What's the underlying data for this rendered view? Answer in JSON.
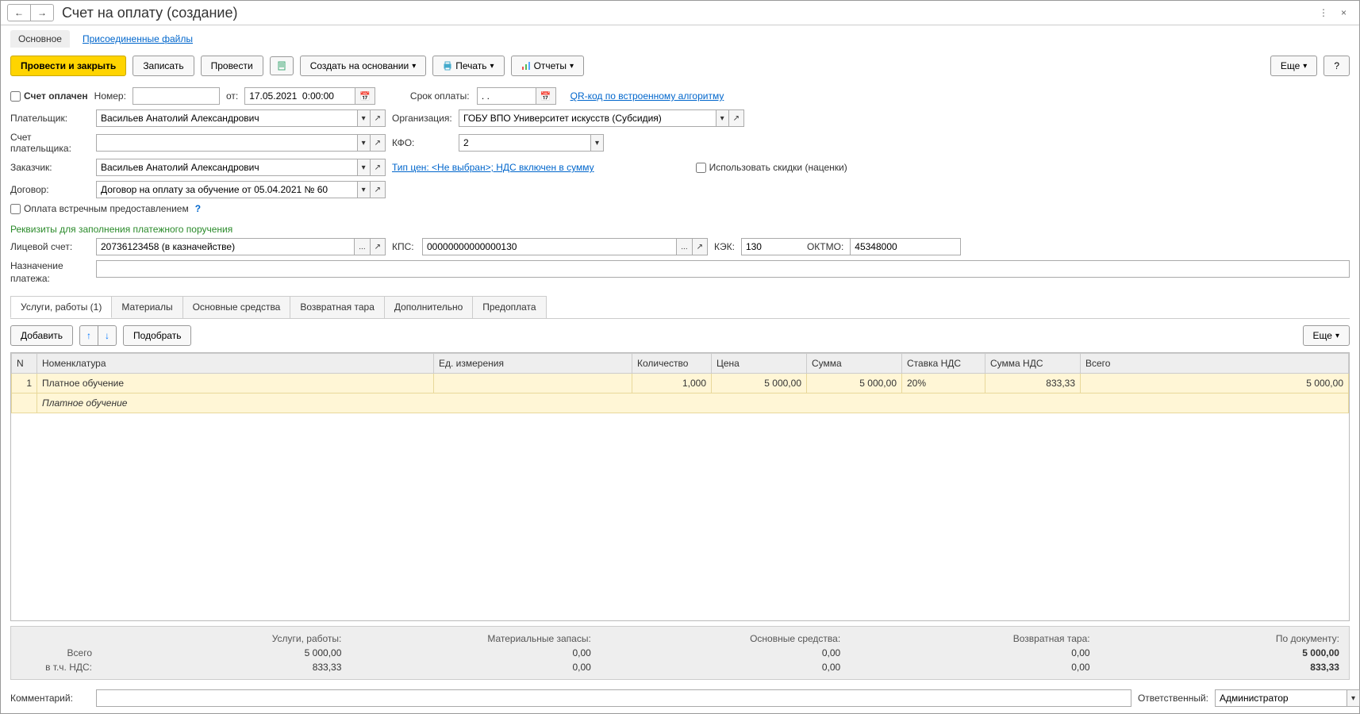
{
  "window": {
    "title": "Счет на оплату (создание)"
  },
  "navTabs": {
    "main": "Основное",
    "files": "Присоединенные файлы"
  },
  "toolbar": {
    "postAndClose": "Провести и закрыть",
    "save": "Записать",
    "post": "Провести",
    "createBased": "Создать на основании",
    "print": "Печать",
    "reports": "Отчеты",
    "more": "Еще",
    "help": "?"
  },
  "fields": {
    "paid_label": "Счет оплачен",
    "number_label": "Номер:",
    "number": "",
    "from_label": "от:",
    "date": "17.05.2021  0:00:00",
    "dueLabel": "Срок оплаты:",
    "due": ". .",
    "qr_link": "QR-код по встроенному алгоритму",
    "payerLabel": "Плательщик:",
    "payer": "Васильев Анатолий Александрович",
    "orgLabel": "Организация:",
    "org": "ГОБУ ВПО Университет искусств (Субсидия)",
    "payerAccLabel": "Счет плательщика:",
    "payerAcc": "",
    "kfoLabel": "КФО:",
    "kfo": "2",
    "customerLabel": "Заказчик:",
    "customer": "Васильев Анатолий Александрович",
    "priceTypeLink": "Тип цен: <Не выбран>; НДС включен в сумму",
    "discountsLabel": "Использовать скидки (наценки)",
    "contractLabel": "Договор:",
    "contract": "Договор на оплату за обучение от 05.04.2021 № 60",
    "counterPaymentLabel": "Оплата встречным предоставлением",
    "requisitesHeader": "Реквизиты для заполнения платежного поручения",
    "personalAccLabel": "Лицевой счет:",
    "personalAcc": "20736123458 (в казначействе)",
    "kpsLabel": "КПС:",
    "kps": "00000000000000130",
    "kekLabel": "КЭК:",
    "kek": "130",
    "oktmoLabel": "ОКТМО:",
    "oktmo": "45348000",
    "purposeLabel": "Назначение платежа:",
    "purpose": ""
  },
  "subTabs": {
    "services": "Услуги, работы (1)",
    "materials": "Материалы",
    "assets": "Основные средства",
    "returnable": "Возвратная тара",
    "additional": "Дополнительно",
    "prepay": "Предоплата"
  },
  "tabToolbar": {
    "add": "Добавить",
    "pick": "Подобрать",
    "more": "Еще"
  },
  "gridHeaders": {
    "n": "N",
    "nomenclature": "Номенклатура",
    "unit": "Ед. измерения",
    "qty": "Количество",
    "price": "Цена",
    "sum": "Сумма",
    "vatRate": "Ставка НДС",
    "vatSum": "Сумма НДС",
    "total": "Всего"
  },
  "gridRow": {
    "n": "1",
    "nomenclature": "Платное обучение",
    "sub": "Платное обучение",
    "unit": "",
    "qty": "1,000",
    "price": "5 000,00",
    "sum": "5 000,00",
    "vatRate": "20%",
    "vatSum": "833,33",
    "total": "5 000,00"
  },
  "summary": {
    "h_services": "Услуги, работы:",
    "h_materials": "Материальные запасы:",
    "h_assets": "Основные средства:",
    "h_returnable": "Возвратная тара:",
    "h_doc": "По документу:",
    "totalLabel": "Всего",
    "vatLabel": "в т.ч. НДС:",
    "services_total": "5 000,00",
    "materials_total": "0,00",
    "assets_total": "0,00",
    "returnable_total": "0,00",
    "doc_total": "5 000,00",
    "services_vat": "833,33",
    "materials_vat": "0,00",
    "assets_vat": "0,00",
    "returnable_vat": "0,00",
    "doc_vat": "833,33"
  },
  "bottom": {
    "commentLabel": "Комментарий:",
    "comment": "",
    "responsibleLabel": "Ответственный:",
    "responsible": "Администратор"
  }
}
